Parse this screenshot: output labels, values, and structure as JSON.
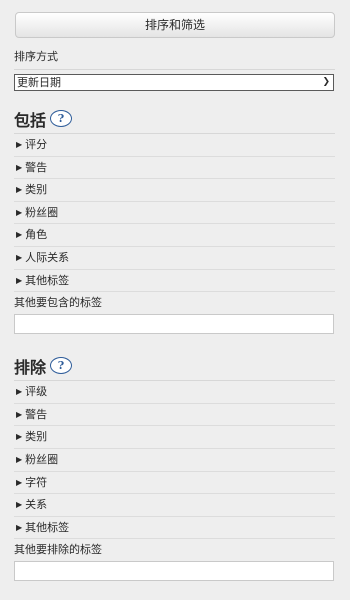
{
  "top_button": "排序和筛选",
  "sort": {
    "label": "排序方式",
    "selected": "更新日期"
  },
  "include": {
    "title": "包括",
    "help": "?",
    "items": [
      "评分",
      "警告",
      "类别",
      "粉丝圈",
      "角色",
      "人际关系",
      "其他标签"
    ],
    "other_label": "其他要包含的标签",
    "other_value": ""
  },
  "exclude": {
    "title": "排除",
    "help": "?",
    "items": [
      "评级",
      "警告",
      "类别",
      "粉丝圈",
      "字符",
      "关系",
      "其他标签"
    ],
    "other_label": "其他要排除的标签",
    "other_value": ""
  },
  "icons": {
    "expand": "triangle-right-icon",
    "help": "question-circle-icon",
    "dropdown": "chevron-down-icon"
  }
}
